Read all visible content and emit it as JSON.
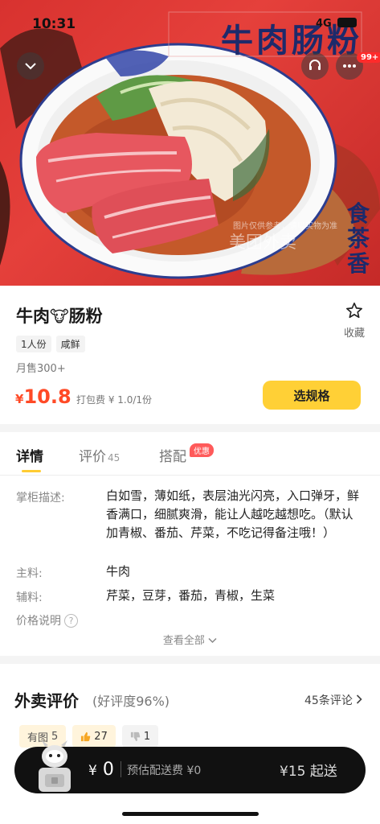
{
  "status_bar": {
    "time": "10:31",
    "network": "4G"
  },
  "hero": {
    "title": "牛肉肠粉",
    "brand": "食茶香",
    "watermark": "美团外卖",
    "disclaimer": "图片仅供参考，请以实物为准",
    "back_icon": "chevron-down-icon",
    "support_icon": "headset-icon",
    "more_icon": "ellipsis-icon",
    "message_badge": "99+"
  },
  "product": {
    "name_part1": "牛肉",
    "emoji": "🐮",
    "name_part2": "肠粉",
    "tags": [
      "1人份",
      "咸鲜"
    ],
    "sales": "月售300+",
    "price_symbol": "¥",
    "price": "10.8",
    "packing_fee": "打包费 ¥ 1.0/1份",
    "select_button": "选规格",
    "favorite_label": "收藏",
    "accent_color": "#ff4a26",
    "button_color": "#ffd036"
  },
  "details": {
    "tabs": [
      {
        "label": "详情",
        "count": ""
      },
      {
        "label": "评价",
        "count": "45"
      },
      {
        "label": "搭配",
        "count": ""
      }
    ],
    "promo_badge": "优惠",
    "rows": [
      {
        "label": "掌柜描述:",
        "value": "白如雪，薄如纸，表层油光闪亮，入口弹牙，鲜香满口，细腻爽滑，能让人越吃越想吃。（默认加青椒、番茄、芹菜，不吃记得备注哦！）"
      },
      {
        "label": "主料:",
        "value": "牛肉"
      },
      {
        "label": "辅料:",
        "value": "芹菜，豆芽，番茄，青椒，生菜"
      },
      {
        "label": "价格说明",
        "value": ""
      }
    ],
    "view_all": "查看全部"
  },
  "reviews": {
    "title": "外卖评价",
    "rating": "(好评度96%)",
    "count_link": "45条评论",
    "chips": [
      {
        "label": "有图",
        "count": "5"
      },
      {
        "label": "",
        "count": "27"
      },
      {
        "label": "",
        "count": "1"
      }
    ]
  },
  "cart": {
    "total_symbol": "¥",
    "total": "0",
    "delivery": "预估配送费 ¥0",
    "min_order": "¥15 起送"
  }
}
